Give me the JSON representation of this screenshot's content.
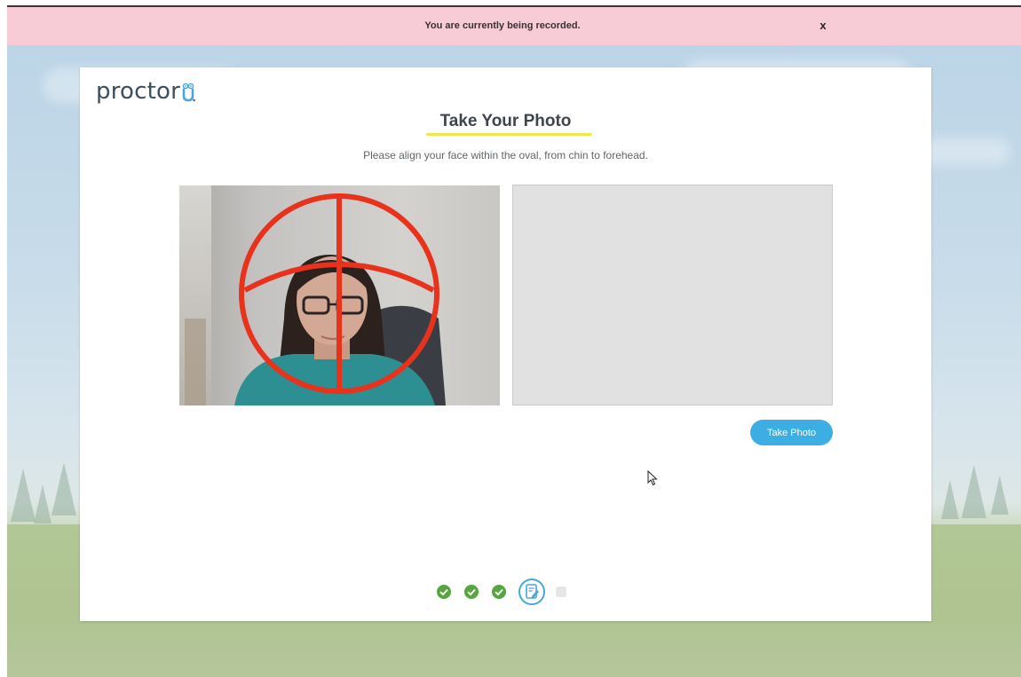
{
  "banner": {
    "message": "You are currently being recorded.",
    "close_label": "x",
    "close_icon": "close-icon"
  },
  "brand": {
    "logo_text": "proctor",
    "logo_mark": "owl-u-logo-icon"
  },
  "page": {
    "title": "Take Your Photo",
    "instructions": "Please align your face within the oval, from chin to forehead."
  },
  "camera": {
    "overlay_icon": "face-alignment-crosshair-icon",
    "overlay_color": "#e8321c"
  },
  "actions": {
    "take_photo_label": "Take Photo"
  },
  "steps": {
    "items": [
      {
        "status": "completed",
        "icon": "check-icon"
      },
      {
        "status": "completed",
        "icon": "check-icon"
      },
      {
        "status": "completed",
        "icon": "check-icon"
      },
      {
        "status": "current",
        "icon": "photo-id-icon"
      },
      {
        "status": "pending",
        "icon": "step-placeholder-icon"
      }
    ]
  },
  "colors": {
    "banner": "#f7ccd6",
    "accent": "#3caee3",
    "title_highlight": "#f0e84a",
    "step_complete": "#55a63f",
    "overlay": "#e8321c"
  }
}
